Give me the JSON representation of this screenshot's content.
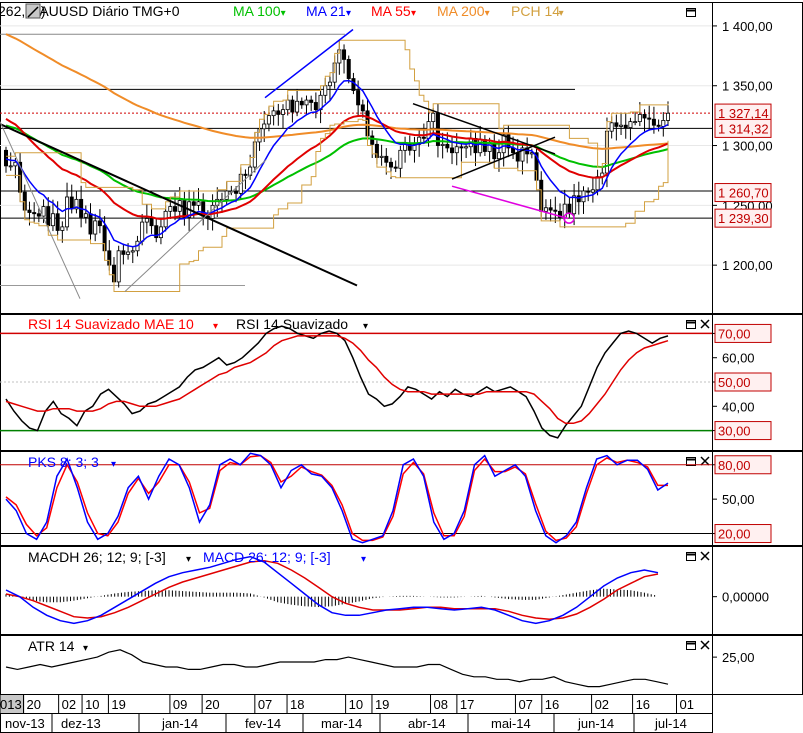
{
  "chart_data": {
    "type": "candlestick",
    "x_dates": [
      "2013-11-13",
      "2013-11-20",
      "2013-12-02",
      "2013-12-10",
      "2013-12-19",
      "2014-01-09",
      "2014-01-20",
      "2014-02-07",
      "2014-02-18",
      "2014-03-10",
      "2014-03-19",
      "2014-04-08",
      "2014-04-17",
      "2014-05-07",
      "2014-05-16",
      "2014-06-02",
      "2014-06-16",
      "2014-07-01"
    ],
    "x_day_labels": [
      "013",
      "20",
      "02",
      "10",
      "19",
      "09",
      "20",
      "07",
      "18",
      "10",
      "19",
      "08",
      "17",
      "07",
      "16",
      "02",
      "16",
      "01"
    ],
    "x_month_labels": [
      "nov-13",
      "dez-13",
      "jan-14",
      "fev-14",
      "mar-14",
      "abr-14",
      "mai-14",
      "jun-14",
      "jul-14"
    ],
    "x_month_dates": [
      "2013-11-13",
      "2013-12-10",
      "2014-01-15",
      "2014-02-15",
      "2014-03-15",
      "2014-04-15",
      "2014-05-15",
      "2014-06-15",
      "2014-07-02"
    ],
    "panes": [
      {
        "id": "price",
        "legend": [
          {
            "label": "262,12)",
            "color": "#000000"
          },
          {
            "label": "XAUUSD Diário TMG+0",
            "color": "#000000"
          },
          {
            "label": "MA 100",
            "color": "#00c000"
          },
          {
            "label": "MA 21",
            "color": "#0000ff"
          },
          {
            "label": "MA 55",
            "color": "#ff0000"
          },
          {
            "label": "MA 200",
            "color": "#f08c28"
          },
          {
            "label": "PCH 14",
            "color": "#d2a040"
          }
        ],
        "ylim": [
          1160,
          1420
        ],
        "y_ticks": [
          1200,
          1250,
          1300,
          1350,
          1400
        ],
        "y_tick_labels": [
          "1 200,00",
          "1 250,00",
          "1 300,00",
          "1 350,00",
          "1 400,00"
        ],
        "value_boxes": [
          {
            "label": "1 327,14",
            "value": 1327.14
          },
          {
            "label": "1 314,32",
            "value": 1314.32
          },
          {
            "label": "1 260,70",
            "value": 1260.7
          },
          {
            "label": "1 239,30",
            "value": 1239.3
          }
        ],
        "ohlc_closes": [
          [
            1283,
            1283,
            1286,
            1261,
            1246,
            1244,
            1243,
            1241,
            1249,
            1233,
            1243,
            1229,
            1232,
            1257,
            1247,
            1255,
            1240,
            1243,
            1226,
            1237,
            1233,
            1212,
            1200,
            1186,
            1212,
            1209,
            1211,
            1212,
            1220,
            1236,
            1239,
            1233,
            1223,
            1232,
            1245,
            1249,
            1245,
            1254,
            1240,
            1253,
            1250,
            1253,
            1241,
            1239,
            1250,
            1255,
            1255,
            1262,
            1262,
            1260,
            1276,
            1275,
            1282,
            1303,
            1314,
            1318,
            1325,
            1329,
            1326,
            1330,
            1338,
            1328,
            1337,
            1334,
            1338,
            1336,
            1330,
            1342,
            1350,
            1353,
            1369,
            1380,
            1372,
            1356,
            1346,
            1334,
            1329,
            1308,
            1301,
            1290,
            1291,
            1286,
            1282,
            1281,
            1296,
            1301,
            1296,
            1301,
            1307,
            1306,
            1320,
            1327,
            1300,
            1301,
            1298,
            1294,
            1299,
            1298,
            1299,
            1306,
            1294,
            1305,
            1295,
            1302,
            1289,
            1294,
            1309,
            1298,
            1294,
            1287,
            1298,
            1293,
            1294,
            1271,
            1245,
            1248,
            1246,
            1245,
            1240,
            1251,
            1243,
            1258,
            1253,
            1262,
            1261,
            1263,
            1274,
            1277,
            1312,
            1319,
            1316,
            1317,
            1315,
            1320,
            1320,
            1326,
            1323,
            1322,
            1317,
            1316,
            1321,
            1327
          ]
        ],
        "hlines": [
          1393,
          1347,
          1314.32,
          1262,
          1239.3,
          1183
        ]
      },
      {
        "id": "rsi",
        "legend": [
          {
            "label": "RSI 14 Suavizado MAE 10",
            "color": "#ff0000"
          },
          {
            "label": "RSI 14 Suavizado",
            "color": "#000000"
          }
        ],
        "ylim": [
          22,
          78
        ],
        "y_ticks": [
          30,
          40,
          50,
          60,
          70
        ],
        "y_tick_labels": [
          "30,00",
          "40,00",
          "50,00",
          "60,00",
          "70,00"
        ],
        "value_boxes": [
          {
            "label": "70,00",
            "value": 70
          },
          {
            "label": "50,00",
            "value": 50
          },
          {
            "label": "30,00",
            "value": 30
          }
        ],
        "series": [
          {
            "name": "RSI 14 Suavizado",
            "color": "#000000",
            "values": [
              43,
              38,
              34,
              31,
              30,
              38,
              42,
              37,
              35,
              32,
              38,
              40,
              45,
              47,
              44,
              41,
              37,
              38,
              41,
              42,
              44,
              46,
              48,
              52,
              55,
              56,
              58,
              60,
              57,
              58,
              60,
              63,
              66,
              70,
              72,
              73,
              72,
              70,
              69,
              68,
              70,
              71,
              70,
              67,
              60,
              52,
              45,
              43,
              40,
              41,
              44,
              48,
              47,
              45,
              43,
              46,
              44,
              47,
              45,
              44,
              46,
              48,
              46,
              47,
              48,
              46,
              44,
              38,
              31,
              28,
              27,
              32,
              36,
              40,
              48,
              56,
              62,
              66,
              70,
              71,
              70,
              68,
              66,
              68,
              69
            ]
          },
          {
            "name": "RSI 14 Suavizado MAE 10",
            "color": "#e00000",
            "values": [
              42,
              41,
              40,
              39,
              38,
              38,
              39,
              39,
              39,
              38,
              38,
              38,
              39,
              41,
              42,
              42,
              41,
              40,
              40,
              40,
              41,
              42,
              43,
              45,
              47,
              49,
              51,
              53,
              54,
              56,
              57,
              58,
              60,
              62,
              65,
              67,
              68,
              69,
              69,
              69,
              69,
              69,
              69,
              68,
              66,
              63,
              59,
              56,
              52,
              49,
              47,
              46,
              46,
              46,
              45,
              45,
              45,
              45,
              45,
              45,
              45,
              46,
              46,
              46,
              46,
              46,
              46,
              45,
              42,
              39,
              35,
              33,
              33,
              34,
              37,
              41,
              45,
              50,
              55,
              59,
              62,
              64,
              65,
              66,
              67
            ]
          }
        ]
      },
      {
        "id": "stoch",
        "legend": [
          {
            "label": "PKS 8; 3; 3",
            "color": "#0000ff"
          }
        ],
        "ylim": [
          10,
          92
        ],
        "y_ticks": [
          20,
          50,
          80
        ],
        "y_tick_labels": [
          "20,00",
          "50,00",
          "80,00"
        ],
        "value_boxes": [
          {
            "label": "80,00",
            "value": 80
          },
          {
            "label": "50,00",
            "value": 50
          },
          {
            "label": "20,00",
            "value": 20
          }
        ],
        "series": [
          {
            "name": "%K",
            "color": "#0000ff",
            "values": [
              50,
              40,
              20,
              15,
              30,
              70,
              85,
              60,
              30,
              15,
              20,
              35,
              60,
              70,
              50,
              70,
              85,
              80,
              60,
              30,
              45,
              80,
              85,
              80,
              90,
              88,
              80,
              60,
              75,
              80,
              72,
              70,
              60,
              40,
              15,
              12,
              15,
              18,
              40,
              80,
              85,
              70,
              30,
              15,
              20,
              40,
              80,
              88,
              70,
              75,
              80,
              70,
              40,
              18,
              12,
              18,
              30,
              60,
              85,
              88,
              80,
              84,
              84,
              76,
              58,
              64
            ]
          },
          {
            "name": "%D",
            "color": "#ff0000",
            "values": [
              52,
              45,
              28,
              18,
              25,
              60,
              80,
              65,
              38,
              20,
              18,
              30,
              55,
              68,
              55,
              65,
              80,
              80,
              65,
              38,
              42,
              75,
              82,
              80,
              87,
              88,
              82,
              65,
              70,
              78,
              74,
              71,
              62,
              45,
              20,
              14,
              14,
              17,
              35,
              72,
              82,
              72,
              38,
              18,
              18,
              35,
              75,
              85,
              74,
              74,
              78,
              72,
              46,
              22,
              14,
              16,
              26,
              55,
              80,
              86,
              82,
              84,
              82,
              78,
              62,
              62
            ]
          }
        ]
      },
      {
        "id": "macd",
        "legend": [
          {
            "label": "MACDH 26; 12; 9; [-3]",
            "color": "#000000"
          },
          {
            "label": "MACD 26; 12; 9; [-3]",
            "color": "#0000ff"
          }
        ],
        "ylim": [
          -28,
          38
        ],
        "y_ticks": [
          0
        ],
        "y_tick_labels": [
          "0,00000"
        ],
        "series": [
          {
            "name": "MACD",
            "color": "#0000ff",
            "values": [
              5,
              0,
              -8,
              -14,
              -18,
              -20,
              -18,
              -14,
              -8,
              -2,
              4,
              10,
              15,
              18,
              20,
              22,
              25,
              28,
              30,
              26,
              18,
              10,
              2,
              -6,
              -12,
              -14,
              -14,
              -12,
              -10,
              -9,
              -8,
              -8,
              -9,
              -10,
              -9,
              -8,
              -10,
              -14,
              -18,
              -20,
              -18,
              -14,
              -8,
              0,
              8,
              14,
              18,
              20,
              18
            ]
          },
          {
            "name": "Signal",
            "color": "#ff0000",
            "values": [
              2,
              0,
              -3,
              -7,
              -11,
              -15,
              -16,
              -15,
              -12,
              -8,
              -3,
              2,
              7,
              11,
              14,
              17,
              20,
              23,
              26,
              27,
              25,
              20,
              14,
              7,
              0,
              -5,
              -8,
              -10,
              -10,
              -10,
              -9,
              -8,
              -8,
              -9,
              -9,
              -9,
              -9,
              -11,
              -14,
              -16,
              -17,
              -16,
              -13,
              -8,
              -2,
              5,
              10,
              15,
              17
            ]
          }
        ]
      },
      {
        "id": "atr",
        "legend": [
          {
            "label": "ATR 14",
            "color": "#000000"
          }
        ],
        "ylim": [
          10,
          34
        ],
        "y_ticks": [
          25
        ],
        "y_tick_labels": [
          "25,00"
        ],
        "series": [
          {
            "name": "ATR 14",
            "color": "#000000",
            "values": [
              21,
              20,
              21,
              22,
              21,
              22,
              23,
              24,
              25,
              27,
              28,
              26,
              23,
              22,
              21,
              21,
              20,
              20,
              21,
              22,
              22,
              21,
              21,
              22,
              23,
              23,
              23,
              23,
              24,
              24,
              25,
              24,
              23,
              22,
              21,
              21,
              21,
              22,
              22,
              20,
              18,
              17,
              17,
              16,
              16,
              15,
              16,
              16,
              17,
              15,
              14,
              13,
              13,
              14,
              15,
              16,
              16,
              15,
              14
            ]
          }
        ]
      }
    ]
  }
}
